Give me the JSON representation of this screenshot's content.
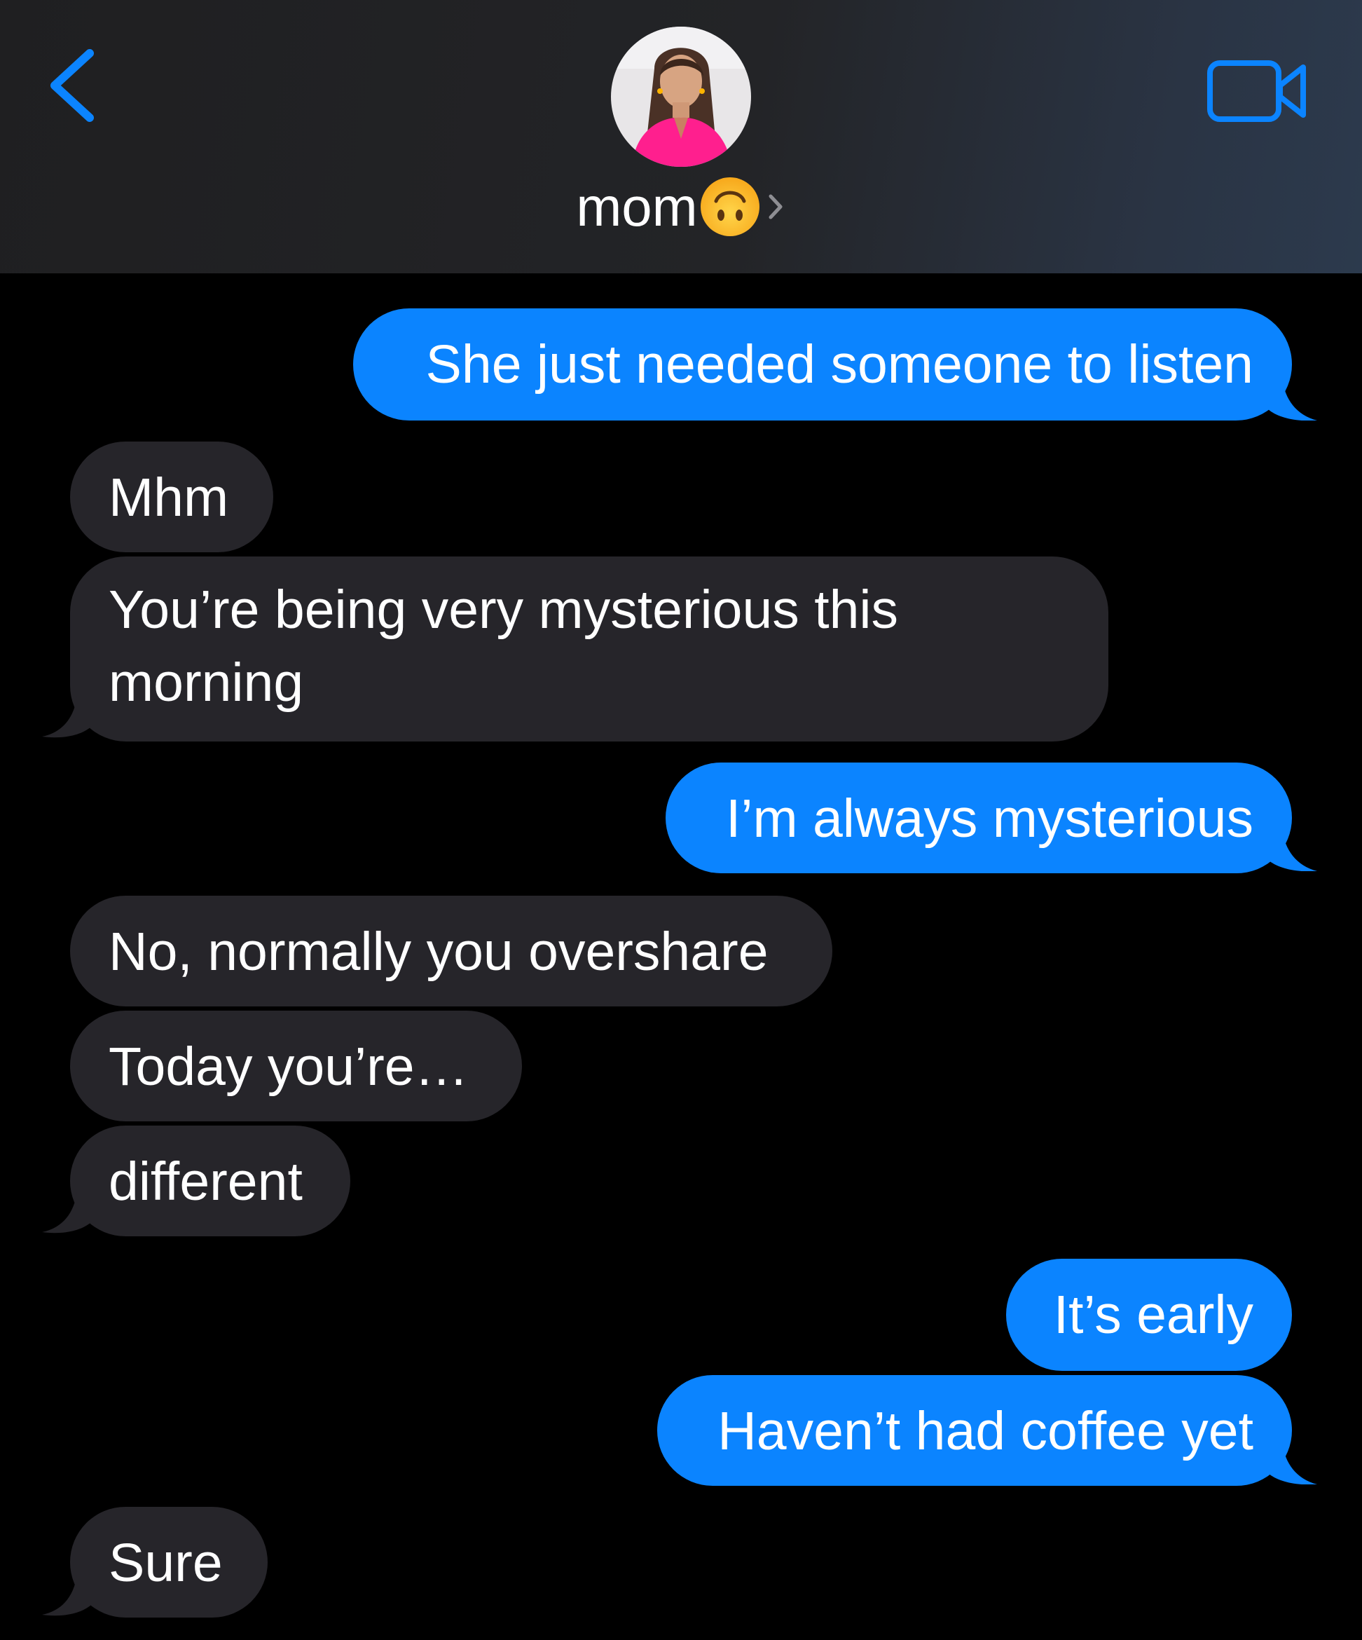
{
  "header": {
    "contact_name": "mom",
    "contact_emoji": "upside-down-face-emoji",
    "back_icon": "chevron-left-icon",
    "video_icon": "video-camera-icon",
    "accent_color": "#0b84ff"
  },
  "messages": [
    {
      "direction": "sent",
      "text": "She just needed someone to listen"
    },
    {
      "direction": "received",
      "text": "Mhm"
    },
    {
      "direction": "received",
      "text": "You’re being very mysterious this morning"
    },
    {
      "direction": "sent",
      "text": "I’m always mysterious"
    },
    {
      "direction": "received",
      "text": "No, normally you overshare"
    },
    {
      "direction": "received",
      "text": "Today you’re…"
    },
    {
      "direction": "received",
      "text": "different"
    },
    {
      "direction": "sent",
      "text": "It’s early"
    },
    {
      "direction": "sent",
      "text": "Haven’t had coffee yet"
    },
    {
      "direction": "received",
      "text": "Sure"
    }
  ],
  "colors": {
    "sent_bubble": "#0b84ff",
    "received_bubble": "#26252a",
    "background": "#000000"
  }
}
